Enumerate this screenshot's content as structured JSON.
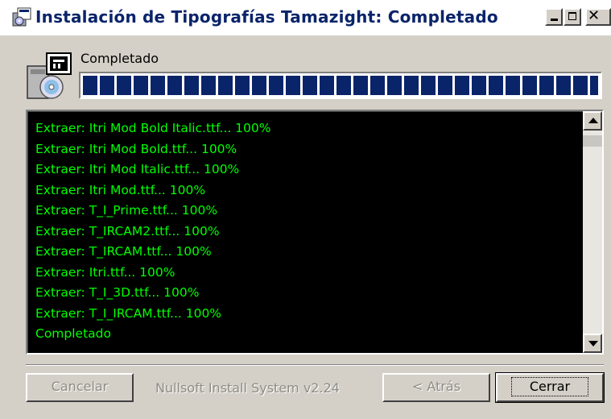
{
  "window": {
    "title": "Instalación de Tipografías Tamazight: Completado",
    "icon": "installer-icon",
    "controls": [
      "minimize-icon",
      "maximize-icon",
      "close-icon"
    ]
  },
  "header": {
    "status": "Completado",
    "icon": "installer-package-icon",
    "progress_fraction": 1.0
  },
  "log": {
    "text_color": "#00ff00",
    "background": "#000000",
    "lines": [
      "Extraer: Itri Mod Bold Italic.ttf... 100%",
      "Extraer: Itri Mod Bold.ttf... 100%",
      "Extraer: Itri Mod Italic.ttf... 100%",
      "Extraer: Itri Mod.ttf... 100%",
      "Extraer: T_I_Prime.ttf... 100%",
      "Extraer: T_IRCAM2.ttf... 100%",
      "Extraer: T_IRCAM.ttf... 100%",
      "Extraer: Itri.ttf... 100%",
      "Extraer: T_I_3D.ttf... 100%",
      "Extraer: T_I_IRCAM.ttf... 100%",
      "Completado"
    ]
  },
  "footer": {
    "cancel_label": "Cancelar",
    "brand": "Nullsoft Install System v2.24",
    "back_label": "< Atrás",
    "close_label": "Cerrar"
  },
  "colors": {
    "title_text": "#0a246a",
    "progress_fill": "#0a246a",
    "face": "#d4d0c8"
  }
}
